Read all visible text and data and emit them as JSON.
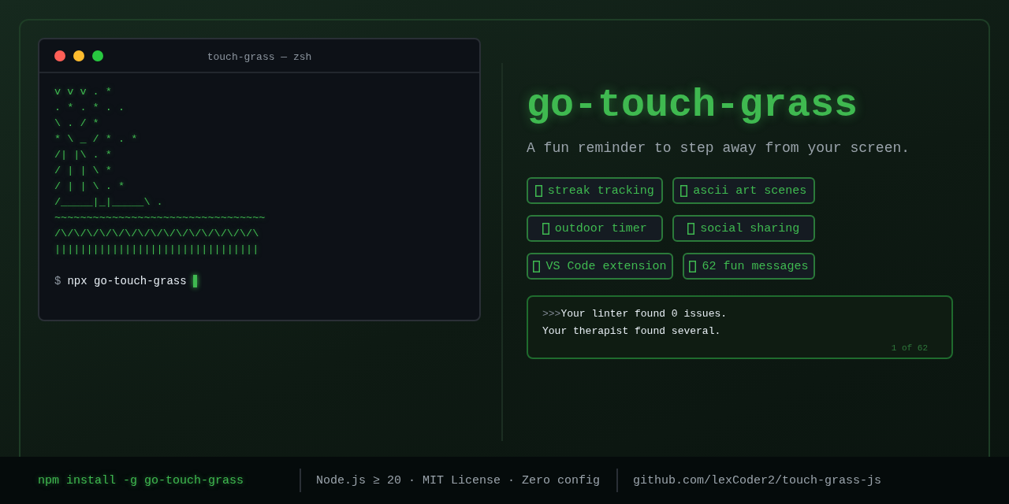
{
  "terminal": {
    "title": "touch-grass — zsh",
    "art": [
      "v v v . *",
      ". * . * . .",
      "\\ . / *",
      "* \\ _ / * . *",
      "/| |\\ . *",
      "/ | | \\ *",
      "/ | | \\ . *",
      "/_____|_|_____\\ .",
      "~~~~~~~~~~~~~~~~~~~~~~~~~~~~~~~~~",
      "/\\/\\/\\/\\/\\/\\/\\/\\/\\/\\/\\/\\/\\/\\/\\/\\",
      "||||||||||||||||||||||||||||||||"
    ],
    "prompt": "$",
    "command": "npx go-touch-grass"
  },
  "title": "go-touch-grass",
  "subtitle": "A fun reminder to step away from your screen.",
  "features": [
    {
      "label": "streak tracking"
    },
    {
      "label": "ascii art scenes"
    },
    {
      "label": "outdoor timer"
    },
    {
      "label": "social sharing"
    },
    {
      "label": "VS Code extension"
    },
    {
      "label": "62 fun messages"
    }
  ],
  "message": {
    "prefix": ">>>",
    "lines": [
      "Your linter found 0 issues.",
      "Your therapist found several."
    ],
    "counter": "1 of 62"
  },
  "footer": {
    "install": "npm install -g go-touch-grass",
    "meta": "Node.js ≥ 20 · MIT License · Zero config",
    "repo": "github.com/lexCoder2/touch-grass-js"
  }
}
